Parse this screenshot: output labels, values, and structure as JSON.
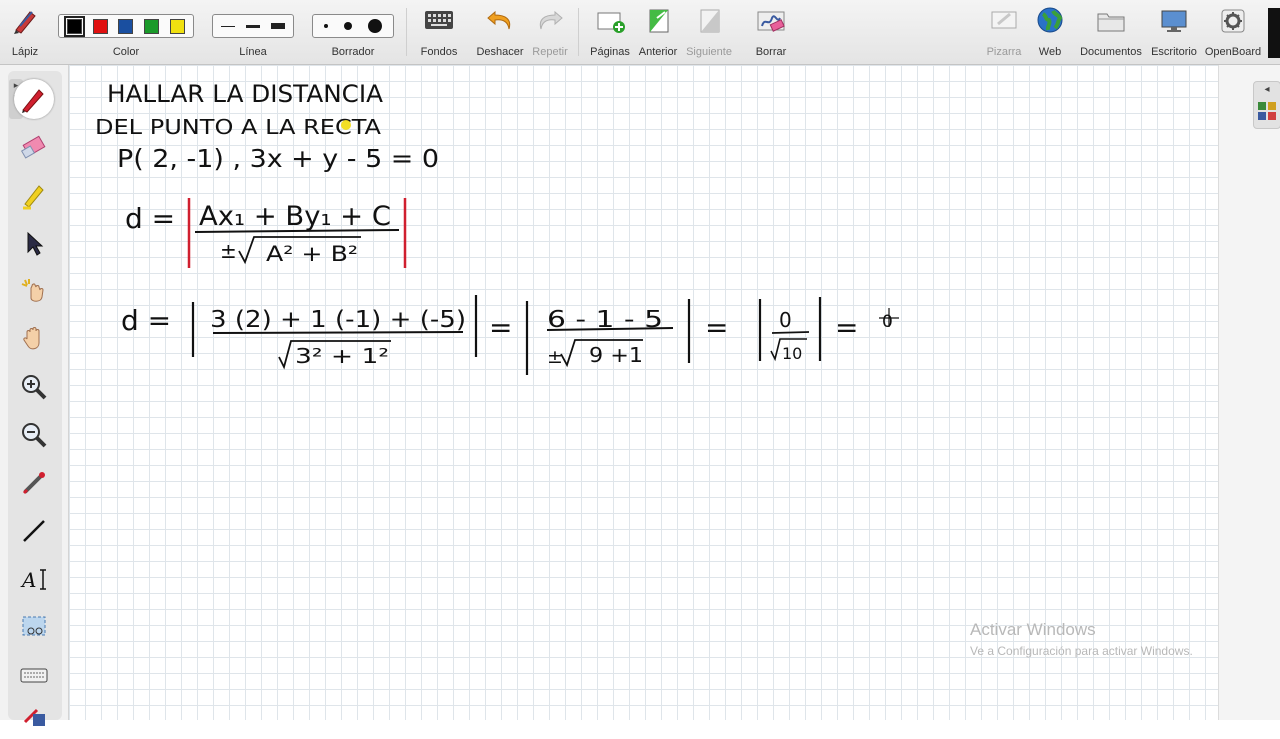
{
  "toolbar": {
    "lapiz": "Lápiz",
    "color": "Color",
    "linea": "Línea",
    "borrador": "Borrador",
    "fondos": "Fondos",
    "deshacer": "Deshacer",
    "repetir": "Repetir",
    "paginas": "Páginas",
    "anterior": "Anterior",
    "siguiente": "Siguiente",
    "borrar": "Borrar",
    "pizarra": "Pizarra",
    "web": "Web",
    "documentos": "Documentos",
    "escritorio": "Escritorio",
    "openboard": "OpenBoard"
  },
  "colors": {
    "swatches": [
      "#000000",
      "#e01010",
      "#1a4fa0",
      "#1a9a2a",
      "#f0e010"
    ],
    "pen_red": "#d01f2f",
    "grid": "#dfe5ea"
  },
  "left_tools": [
    "pen-tool-icon",
    "eraser-tool-icon",
    "highlighter-tool-icon",
    "selector-arrow-icon",
    "interact-hand-icon",
    "hand-pan-icon",
    "zoom-in-icon",
    "zoom-out-icon",
    "laser-pointer-icon",
    "line-tool-icon",
    "text-tool-icon",
    "capture-tool-icon",
    "keyboard-icon",
    "draw-shape-icon"
  ],
  "board": {
    "title_line1": "HALLAR LA DISTANCIA",
    "title_line2": "DEL PUNTO A LA RECTA",
    "problem": "P( 2, -1) ,  3x + y - 5 = 0",
    "formula_lhs": "d =",
    "formula_num": "Ax₁ + By₁ + C",
    "formula_den_sign": "±",
    "formula_den": "A² + B²",
    "calc_lhs": "d =",
    "calc_num": "3 (2) + 1 (-1) + (-5)",
    "calc_den": "3² +  1²",
    "eq": "=",
    "step2_num": "6 - 1 - 5",
    "step2_den_sign": "±",
    "step2_den": "9 +1",
    "step3_num": "0",
    "step3_den": "10",
    "step4_partial": "0"
  },
  "watermark": {
    "title": "Activar Windows",
    "subtitle": "Ve a Configuración para activar Windows."
  }
}
